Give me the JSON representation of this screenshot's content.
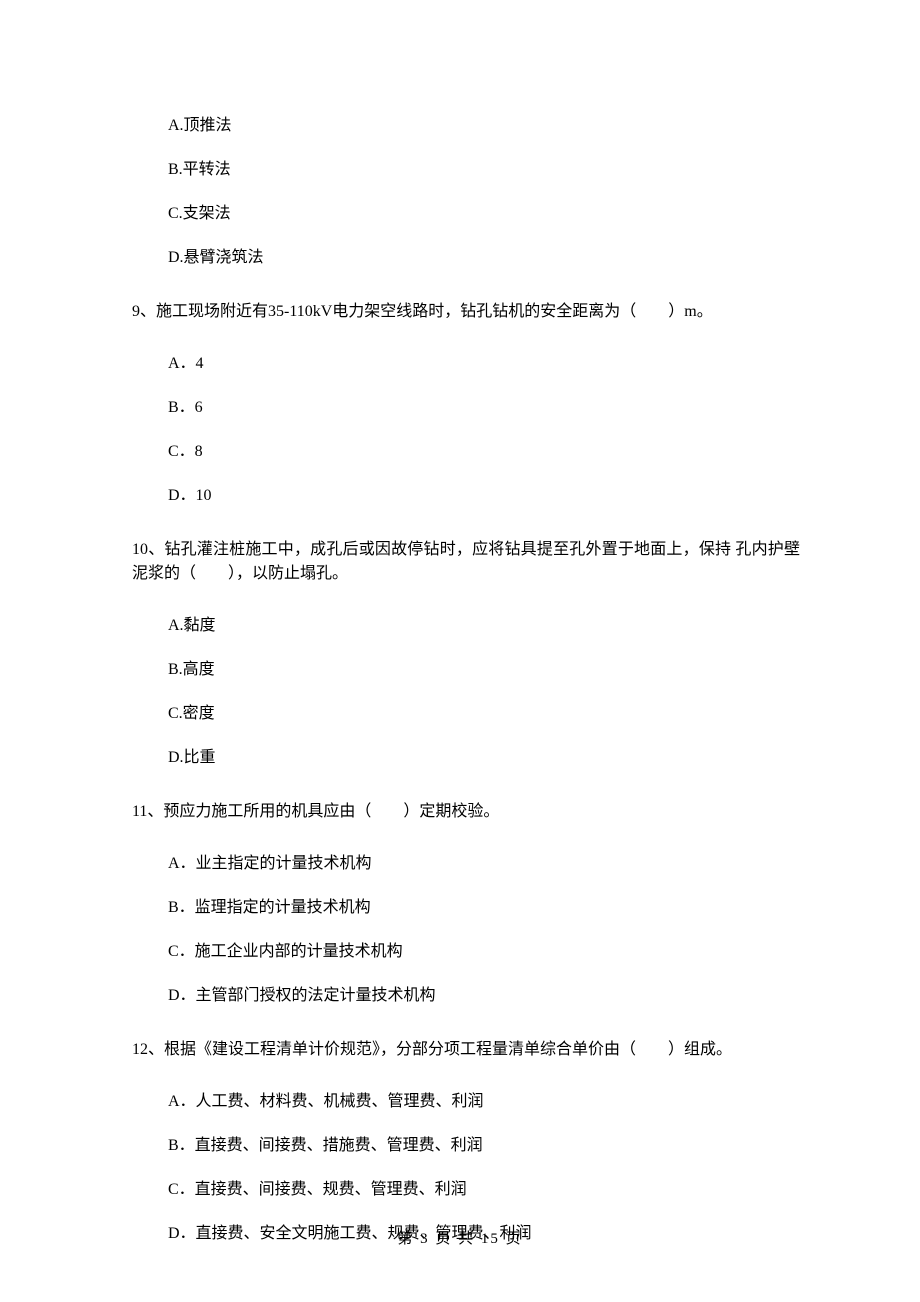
{
  "q_prev_options": {
    "a": "A.顶推法",
    "b": "B.平转法",
    "c": "C.支架法",
    "d": "D.悬臂浇筑法"
  },
  "q9": {
    "stem": "9、施工现场附近有35-110kV电力架空线路时，钻孔钻机的安全距离为（　　）m。",
    "a": "A．4",
    "b": "B．6",
    "c": "C．8",
    "d": "D．10"
  },
  "q10": {
    "stem": "10、钻孔灌注桩施工中，成孔后或因故停钻时，应将钻具提至孔外置于地面上，保持 孔内护壁泥浆的（　　），以防止塌孔。",
    "a": "A.黏度",
    "b": "B.高度",
    "c": "C.密度",
    "d": "D.比重"
  },
  "q11": {
    "stem": "11、预应力施工所用的机具应由（　　）定期校验。",
    "a": "A．业主指定的计量技术机构",
    "b": "B．监理指定的计量技术机构",
    "c": "C．施工企业内部的计量技术机构",
    "d": "D．主管部门授权的法定计量技术机构"
  },
  "q12": {
    "stem": "12、根据《建设工程清单计价规范》，分部分项工程量清单综合单价由（　　）组成。",
    "a": "A．人工费、材料费、机械费、管理费、利润",
    "b": "B．直接费、间接费、措施费、管理费、利润",
    "c": "C．直接费、间接费、规费、管理费、利润",
    "d": "D．直接费、安全文明施工费、规费、管理费、利润"
  },
  "footer": "第 3 页 共 15 页"
}
